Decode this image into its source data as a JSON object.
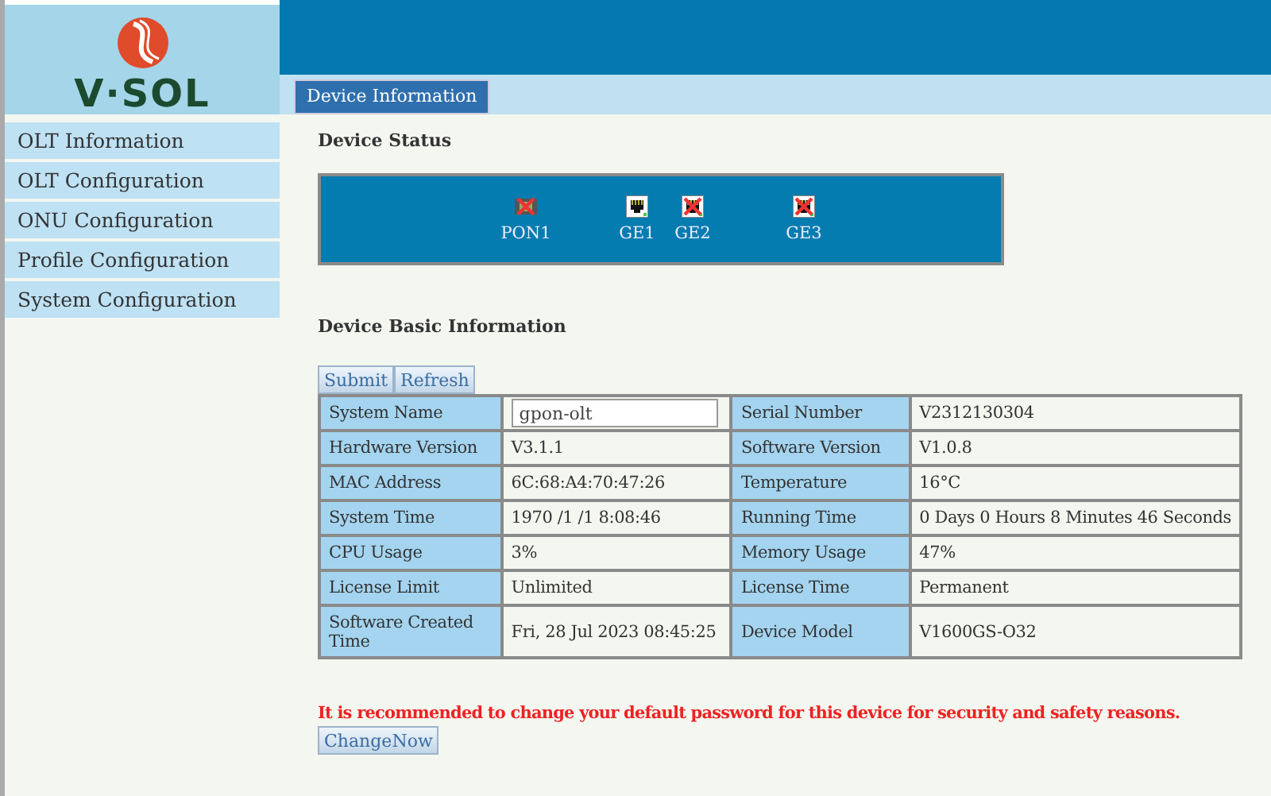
{
  "logo": {
    "text": "V·SOL"
  },
  "sidebar": {
    "items": [
      {
        "label": "OLT Information"
      },
      {
        "label": "OLT Configuration"
      },
      {
        "label": "ONU Configuration"
      },
      {
        "label": "Profile Configuration"
      },
      {
        "label": "System Configuration"
      }
    ]
  },
  "tabs": [
    {
      "label": "Device Information",
      "selected": true
    }
  ],
  "device_status": {
    "title": "Device Status",
    "ports": [
      {
        "label": "PON1",
        "kind": "pon",
        "up": false
      },
      {
        "label": "GE1",
        "kind": "ge",
        "up": true
      },
      {
        "label": "GE2",
        "kind": "ge",
        "up": false
      },
      {
        "label": "GE3",
        "kind": "ge",
        "up": false
      }
    ]
  },
  "basic_info": {
    "title": "Device Basic Information",
    "buttons": [
      "Submit",
      "Refresh"
    ],
    "rows": [
      [
        {
          "label": "System Name",
          "value": "gpon-olt",
          "kind": "input"
        },
        {
          "label": "Serial Number",
          "value": "V2312130304",
          "kind": "text"
        }
      ],
      [
        {
          "label": "Hardware Version",
          "value": "V3.1.1",
          "kind": "text"
        },
        {
          "label": "Software Version",
          "value": "V1.0.8",
          "kind": "text"
        }
      ],
      [
        {
          "label": "MAC Address",
          "value": "6C:68:A4:70:47:26",
          "kind": "text"
        },
        {
          "label": "Temperature",
          "value": "16°C",
          "kind": "text"
        }
      ],
      [
        {
          "label": "System Time",
          "value": "1970 /1 /1 8:08:46",
          "kind": "text"
        },
        {
          "label": "Running Time",
          "value": "0 Days 0 Hours 8 Minutes 46 Seconds",
          "kind": "text"
        }
      ],
      [
        {
          "label": "CPU Usage",
          "value": "3%",
          "kind": "text"
        },
        {
          "label": "Memory Usage",
          "value": "47%",
          "kind": "text"
        }
      ],
      [
        {
          "label": "License Limit",
          "value": "Unlimited",
          "kind": "text"
        },
        {
          "label": "License Time",
          "value": "Permanent",
          "kind": "text"
        }
      ],
      [
        {
          "label": "Software Created Time",
          "value": "Fri, 28 Jul 2023 08:45:25",
          "kind": "text"
        },
        {
          "label": "Device Model",
          "value": "V1600GS-O32",
          "kind": "text"
        }
      ]
    ]
  },
  "warning": {
    "text": "It is recommended to change your default password for this device for security and safety reasons.",
    "button": "ChangeNow"
  }
}
